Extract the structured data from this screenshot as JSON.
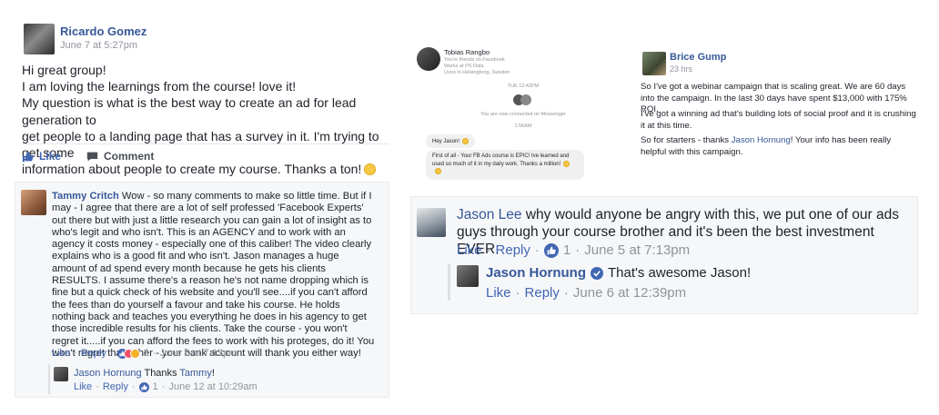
{
  "post": {
    "author": "Ricardo Gomez",
    "time": "June 7 at 5:27pm",
    "lines": [
      "Hi great group!",
      "I am loving the learnings from the course! love it!",
      "My question is what is the best way to create an ad for lead generation to",
      "get people to a landing page that has a survey in it. I'm trying to get some",
      "information about people to create my course. Thanks a ton!"
    ],
    "like_label": "Like",
    "comment_label": "Comment"
  },
  "comment1": {
    "author": "Tammy Critch",
    "text": "Wow - so many comments to make so little time. But if I may - I agree that there are a lot of self professed 'Facebook Experts' out there but with just a little research you can gain a lot of insight as to who's legit and who isn't. This is an AGENCY and to work with an agency it costs money - especially one of this caliber! The video clearly explains who is a good fit and who isn't. Jason manages a huge amount of ad spend every month because he gets his clients RESULTS. I assume there's a reason he's not name dropping which is fine but a quick check of his website and you'll see....if you can't afford the fees than do yourself a favour and take his course. He holds nothing back and teaches you everything he does in his agency to get those incredible results for his clients. Take the course - you won't regret it.....if you can afford the fees to work with his proteges, do it! You won't regret that either - your bank account will thank you either way!",
    "like": "Like",
    "reply": "Reply",
    "reaction_count": "2",
    "time": "June 8 at 7:13pm",
    "reply_author": "Jason Hornung",
    "reply_text": "Thanks",
    "reply_mention": "Tammy",
    "reply_suffix": "!",
    "reply_like": "Like",
    "reply_reply": "Reply",
    "reply_count": "1",
    "reply_time": "June 12 at 10:29am"
  },
  "messenger": {
    "name": "Tobias Rangbo",
    "sub1": "You're friends on Facebook",
    "sub2": "Works at PS Data",
    "sub3": "Lives in Helsingborg, Sweden",
    "date": "TUE 12:42PM",
    "connect": "You are now connected on Messenger",
    "time2": "1:56AM",
    "bubble1": "Hey Jason!",
    "bubble2": "First of all - Your FB Ads course is EPIC! Ive learned and used so much of it in my daily work. Thanks a million!"
  },
  "brice": {
    "author": "Brice Gump",
    "time": "23 hrs",
    "p1": "So I've got a webinar campaign that is scaling great. We are 60 days into the campaign. In the last 30 days have spent $13,000 with 175% ROI.",
    "p2": "I've got a winning ad that's building lots of social proof and it is crushing it at this time.",
    "p3_pre": "So for starters - thanks",
    "p3_mention": "Jason Hornung",
    "p3_post": "! Your info has been really helpful with this campaign."
  },
  "jasonlee": {
    "author": "Jason Lee",
    "text": "why would anyone be angry with this, we put one of our ads guys through your course brother and it's been the best investment EVER.",
    "like": "Like",
    "reply": "Reply",
    "count": "1",
    "time": "June 5 at 7:13pm",
    "reply_author": "Jason Hornung",
    "reply_text": "That's awesome Jason!",
    "reply_like": "Like",
    "reply_reply": "Reply",
    "reply_time": "June 6 at 12:39pm"
  },
  "colors": {
    "link": "#365899",
    "meta": "#90949c",
    "accent": "#4267b2"
  }
}
